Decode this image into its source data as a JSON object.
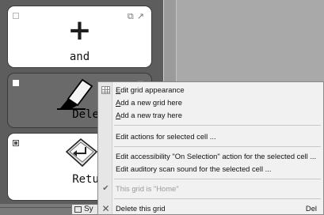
{
  "grid": {
    "cells": {
      "and": {
        "label": "and",
        "symbol": "+"
      },
      "delete": {
        "label": "Delete"
      },
      "return": {
        "label": "Return"
      }
    },
    "corner_icons": [
      "copy-icon",
      "arrow-up-right-icon"
    ]
  },
  "context_menu": {
    "edit_grid_appearance": {
      "pre": "",
      "accel": "E",
      "post": "dit grid appearance"
    },
    "add_grid": {
      "pre": "",
      "accel": "A",
      "post": "dd a new grid here"
    },
    "add_tray": {
      "pre": "",
      "accel": "A",
      "post": "dd a new tray here"
    },
    "edit_actions": "Edit actions for selected cell ...",
    "edit_accessibility": "Edit accessibility \"On Selection\" action for the selected cell ...",
    "edit_auditory": "Edit auditory scan sound for the selected cell ...",
    "home_check": "This grid is \"Home\"",
    "delete_grid": "Delete this grid",
    "delete_shortcut": "Del"
  },
  "tab": {
    "label": "Sy"
  },
  "colors": {
    "panel_bg": "#5d5d5d",
    "cell_bg": "#ffffff",
    "selected_cell_bg": "#6a6a6a",
    "menu_bg": "#f1f1f1"
  }
}
